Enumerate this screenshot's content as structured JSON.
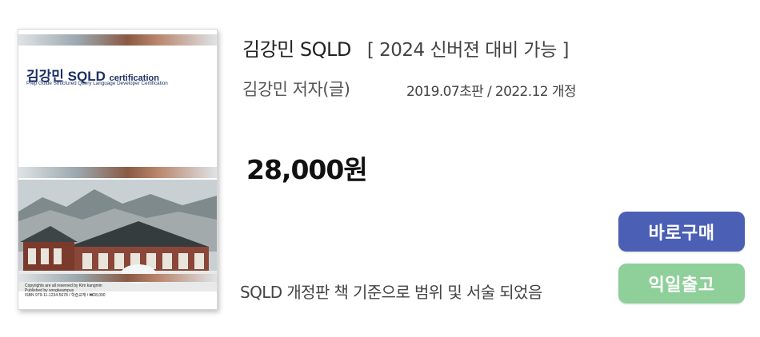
{
  "book": {
    "title": "김강민 SQLD",
    "edition_note": "[ 2024 신버젼 대비 가능 ]",
    "author": "김강민 저자(글)",
    "dates": "2019.07초판 / 2022.12 개정",
    "price": "28,000원",
    "description": "SQLD  개정판 책 기준으로 범위 및 서술 되었음"
  },
  "cover": {
    "title_main": "김강민 SQLD ",
    "title_small": "certification",
    "subtitle": "Prep Guide  Structured Query Language Developer Certification",
    "copyright_line1": "Copyrights are all reserved by Kim kangmin",
    "copyright_line2": "Published by songkeampus",
    "copyright_line3": "ISBN 979-11-1234-5678 / 학습교재 / ₩28,000"
  },
  "actions": {
    "buy_label": "바로구매",
    "sample_label": "익일출고"
  },
  "colors": {
    "buy_button": "#4b5fb5",
    "sample_button": "#8fcf9a",
    "cover_title": "#1c2f63"
  }
}
